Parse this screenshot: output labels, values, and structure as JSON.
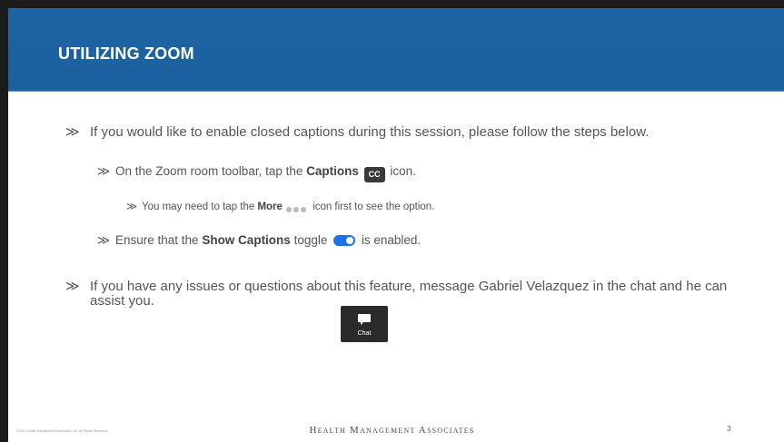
{
  "slide": {
    "title": "UTILIZING ZOOM",
    "page_number": "3"
  },
  "bullets": {
    "marker": "≫",
    "b1_text": "If you would like to enable closed captions during this session, please follow the steps below.",
    "b2_pre": "On the Zoom room toolbar, tap the ",
    "b2_bold": "Captions",
    "b2_post": " icon.",
    "cc_label": "CC",
    "b3_pre": "You may need to tap the ",
    "b3_bold": "More",
    "b3_post": " icon first to see the option.",
    "b4_pre": "Ensure that the ",
    "b4_bold": "Show Captions",
    "b4_mid": " toggle ",
    "b4_post": " is enabled.",
    "b5_text": "If you have any issues or questions about this feature, message Gabriel Velazquez in the chat and he can assist you."
  },
  "chat_button": {
    "label": "Chat",
    "icon": "chat-bubble-icon"
  },
  "footer": {
    "brand": "Health Management Associates",
    "copyright": "©2024 Health Management Associates, Inc. All Rights Reserved."
  },
  "colors": {
    "header_blue": "#1a5f9e",
    "toggle_blue": "#1a73e8",
    "icon_dark": "#3a3a3a"
  }
}
